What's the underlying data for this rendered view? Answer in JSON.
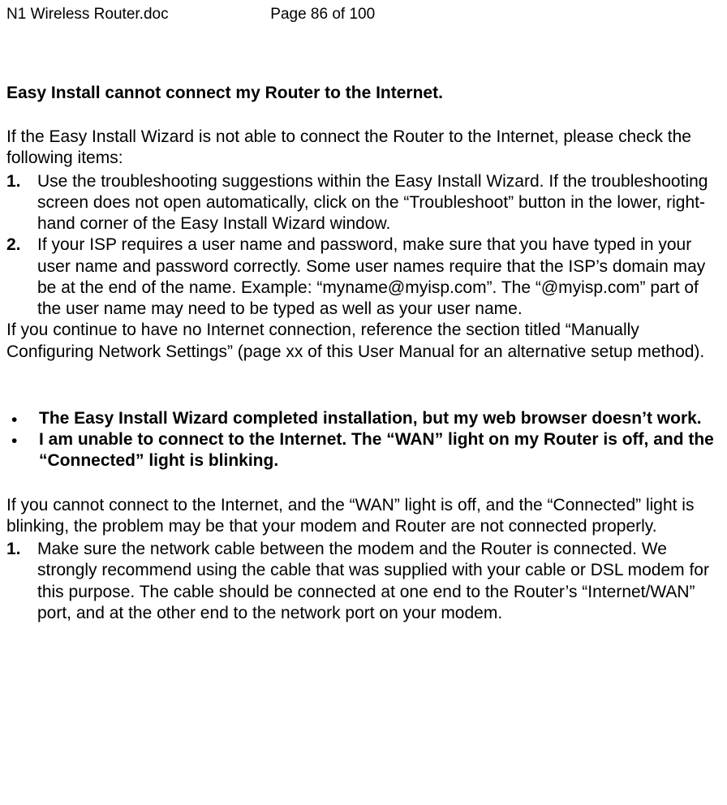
{
  "header": {
    "filename": "N1 Wireless Router.doc",
    "page_label": "Page 86 of 100"
  },
  "section1": {
    "heading": "Easy Install cannot connect my Router to the Internet.",
    "intro": "If the Easy Install Wizard is not able to connect the Router to the Internet, please check the following items:",
    "items": [
      {
        "marker": "1.",
        "text": "Use the troubleshooting suggestions within the Easy Install Wizard. If the troubleshooting screen does not open automatically, click on the “Troubleshoot” button in the lower, right-hand corner of the Easy Install Wizard window."
      },
      {
        "marker": "2.",
        "text": "If your ISP requires a user name and password, make sure that you have typed in your user name and password correctly. Some user names require that the ISP’s domain may be at the end of the name. Example: “myname@myisp.com”. The “@myisp.com” part of the user name may need to be typed as well as your user name."
      }
    ],
    "outro": "If you continue to have no Internet connection, reference the section titled “Manually Configuring Network Settings” (page xx of this User Manual for an alternative setup method)."
  },
  "section2": {
    "bullets": [
      "The Easy Install Wizard completed installation, but my web browser doesn’t work.",
      "I am unable to connect to the Internet. The “WAN” light on my Router is off, and the   “Connected” light is blinking."
    ],
    "intro": "If you cannot connect to the Internet, and the “WAN” light is off, and the “Connected” light is blinking, the problem may be that your modem and Router are not connected properly.",
    "items": [
      {
        "marker": "1.",
        "text": "Make sure the network cable between the modem and the Router is connected. We strongly recommend using the cable that was supplied with your cable or DSL modem for this purpose. The cable should be connected at one end to the Router’s “Internet/WAN” port, and at the other end to the network port on your modem."
      }
    ]
  }
}
